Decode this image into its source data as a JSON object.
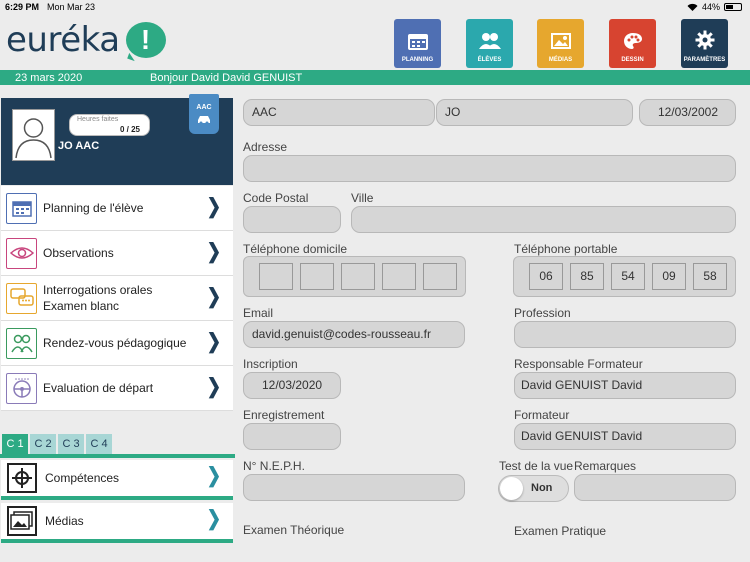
{
  "status": {
    "time": "6:29 PM",
    "date": "Mon Mar 23",
    "battery": "44%"
  },
  "brand": {
    "word": "euréka",
    "mark": "!"
  },
  "nav": [
    {
      "label": "PLANNING",
      "color": "#4f6fb3"
    },
    {
      "label": "ÉLÈVES",
      "color": "#2ba8ad"
    },
    {
      "label": "MÉDIAS",
      "color": "#e6a72e"
    },
    {
      "label": "DESSIN",
      "color": "#d74430"
    },
    {
      "label": "PARAMÈTRES",
      "color": "#1f3d57"
    }
  ],
  "banner": {
    "date": "23 mars 2020",
    "greeting": "Bonjour David David GENUIST"
  },
  "student": {
    "name": "JO AAC",
    "hours_label": "Heures faites",
    "hours_value": "0 / 25",
    "badge": "AAC"
  },
  "menu": [
    {
      "label": "Planning de l'élève",
      "icon": "calendar-icon",
      "color": "#4f6fb3"
    },
    {
      "label": "Observations",
      "icon": "eye-icon",
      "color": "#c8457d"
    },
    {
      "label": "Interrogations orales\nExamen blanc",
      "icon": "chat-icon",
      "color": "#e6a72e"
    },
    {
      "label": "Rendez-vous pédagogique",
      "icon": "people-icon",
      "color": "#3a9a5e"
    },
    {
      "label": "Evaluation de départ",
      "icon": "steering-wheel-icon",
      "color": "#8a7bb8"
    }
  ],
  "tabs": [
    "C 1",
    "C 2",
    "C 3",
    "C 4"
  ],
  "sections": [
    {
      "label": "Compétences",
      "icon": "target-icon"
    },
    {
      "label": "Médias",
      "icon": "photos-icon"
    }
  ],
  "form": {
    "lastname": "AAC",
    "firstname": "JO",
    "birthdate": "12/03/2002",
    "address_label": "Adresse",
    "address": "",
    "postal_label": "Code Postal",
    "postal": "",
    "city_label": "Ville",
    "city": "",
    "home_phone_label": "Téléphone domicile",
    "home_phone": [
      "",
      "",
      "",
      "",
      ""
    ],
    "mobile_label": "Téléphone portable",
    "mobile": [
      "06",
      "85",
      "54",
      "09",
      "58"
    ],
    "email_label": "Email",
    "email": "david.genuist@codes-rousseau.fr",
    "profession_label": "Profession",
    "profession": "",
    "inscription_label": "Inscription",
    "inscription": "12/03/2020",
    "resp_label": "Responsable Formateur",
    "resp": "David GENUIST David",
    "enreg_label": "Enregistrement",
    "enreg": "",
    "formateur_label": "Formateur",
    "formateur": "David GENUIST David",
    "neph_label": "N° N.E.P.H.",
    "neph": "",
    "vue_label": "Test de la vue",
    "vue_value": "Non",
    "remarks_label": "Remarques",
    "remarks": "",
    "theory_label": "Examen Théorique",
    "practice_label": "Examen Pratique"
  }
}
